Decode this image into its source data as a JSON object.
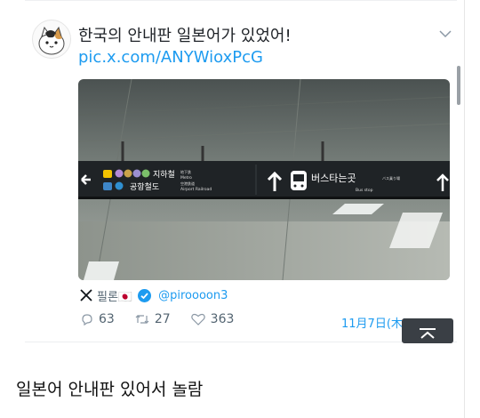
{
  "tweet": {
    "text": "한국의 안내판 일본어가 있었어!",
    "link": "pic.x.com/ANYWioxPcG",
    "source_name": "필론🇯🇵",
    "handle": "@piroooon3",
    "replies": "63",
    "retweets": "27",
    "likes": "363",
    "date": "11月7日(木) 15:16"
  },
  "sign": {
    "left_line": "지하철",
    "left_line_en": "Metro",
    "left_line2": "공항철도",
    "left_line2_en": "Airport Railroad",
    "right_label": "버스타는곳",
    "right_label_en": "Bus stop",
    "small1": "地下鉄",
    "small2": "空港鉄道",
    "small3": "バス乗り場"
  },
  "post": {
    "body": "일본어 안내판 있어서 놀람"
  },
  "colors": {
    "link": "#1d9bf0",
    "muted": "#536471",
    "verified": "#1d9bf0"
  }
}
